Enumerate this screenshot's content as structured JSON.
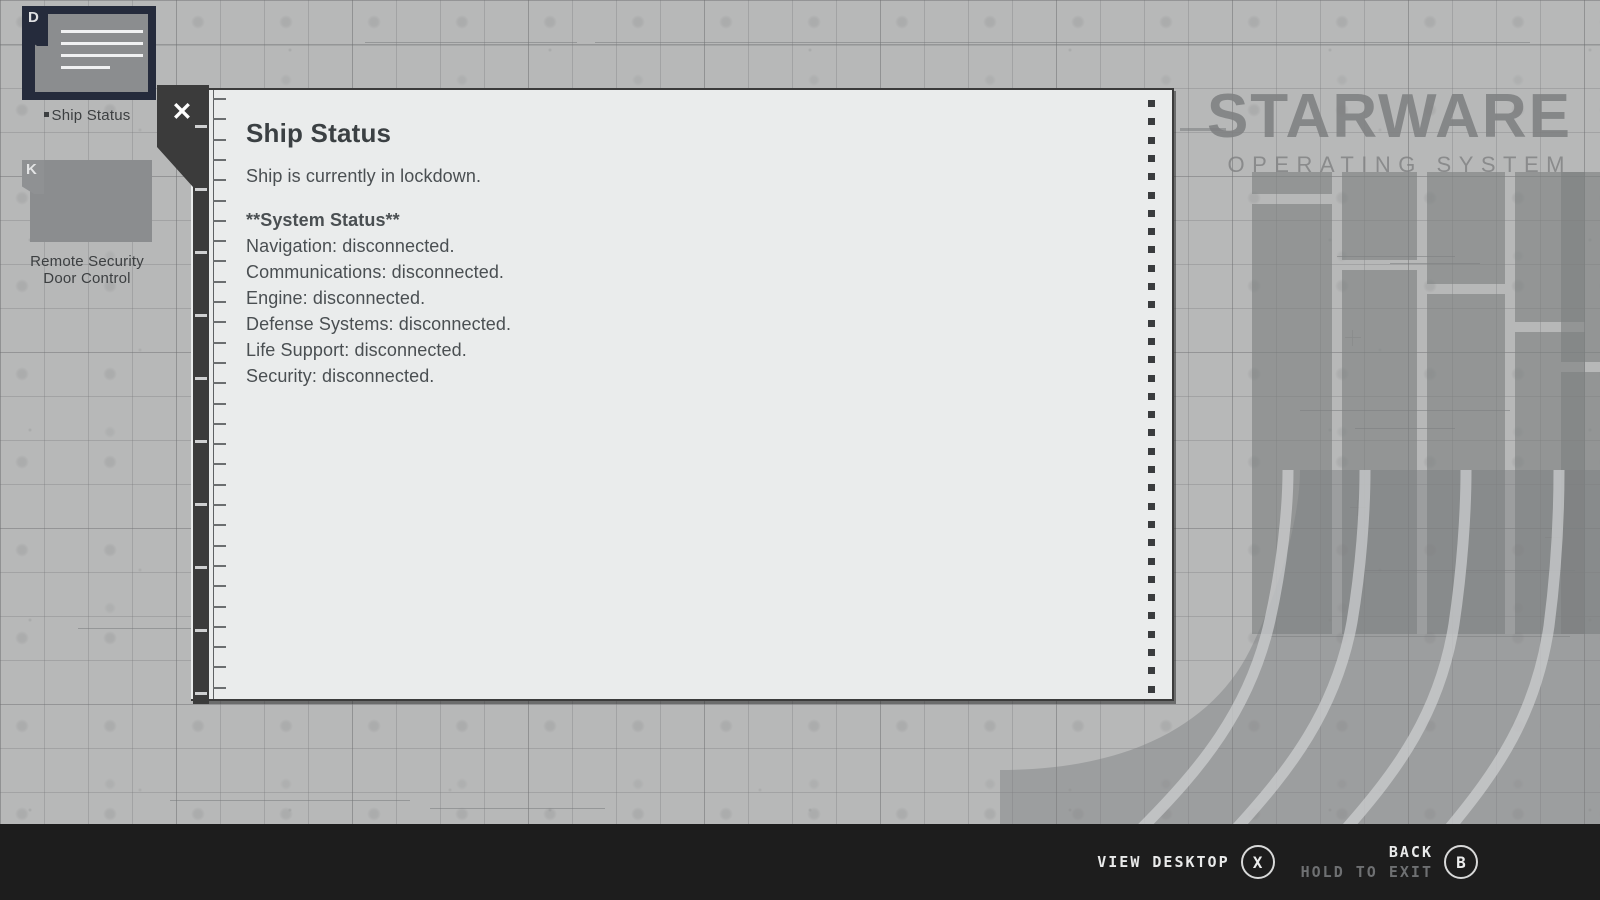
{
  "branding": {
    "name": "STARWARE",
    "tagline": "OPERATING SYSTEM"
  },
  "desktop": {
    "icons": [
      {
        "id": "ship-status",
        "tab_letter": "D",
        "label": "Ship Status",
        "selected": true
      },
      {
        "id": "remote-security-door-control",
        "tab_letter": "K",
        "label": "Remote Security\nDoor Control",
        "label_line1": "Remote Security",
        "label_line2": "Door Control",
        "selected": false
      }
    ]
  },
  "window": {
    "close_label": "✕",
    "document": {
      "title": "Ship Status",
      "lead": "Ship is currently in lockdown.",
      "section_heading": "**System Status**",
      "status_lines": [
        "Navigation: disconnected.",
        "Communications: disconnected.",
        "Engine: disconnected.",
        "Defense Systems: disconnected.",
        "Life Support: disconnected.",
        "Security: disconnected."
      ]
    }
  },
  "hud": {
    "actions": [
      {
        "id": "view-desktop",
        "primary": "VIEW DESKTOP",
        "secondary": "",
        "button": "X"
      },
      {
        "id": "back",
        "primary": "BACK",
        "secondary": "HOLD TO EXIT",
        "button": "B"
      }
    ]
  },
  "colors": {
    "desktop_bg": "#b7b8b8",
    "paper_bg": "#eaecec",
    "sidebar_dark": "#3b3b3b",
    "hud_bg": "#1d1d1d",
    "icon_selected_border": "#252b3c",
    "text_dark": "#4a4f52"
  }
}
